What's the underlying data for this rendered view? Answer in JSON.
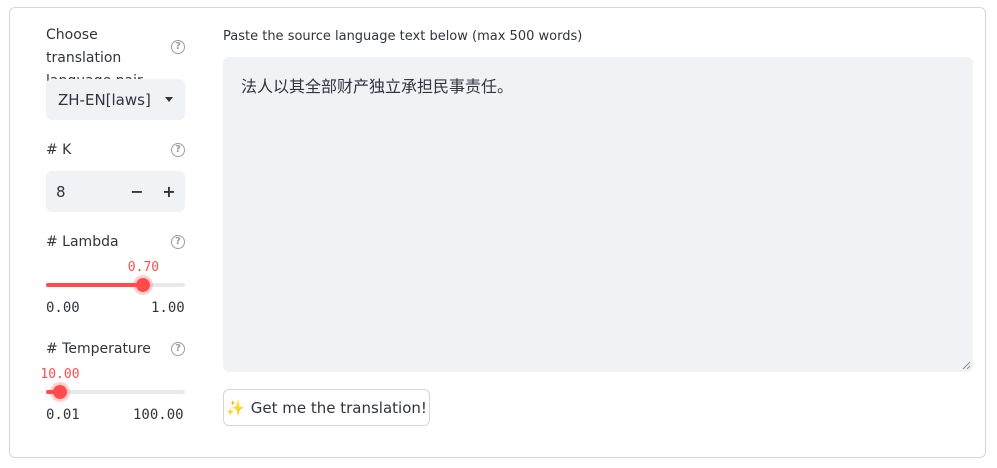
{
  "sidebar": {
    "pair": {
      "label": "Choose translation language pair",
      "selected": "ZH-EN[laws]"
    },
    "k": {
      "label": "# K",
      "value": "8",
      "minus": "−",
      "plus": "+"
    },
    "lambda": {
      "label": "# Lambda",
      "value": "0.70",
      "min": "0.00",
      "max": "1.00",
      "level": 0.7
    },
    "temperature": {
      "label": "# Temperature",
      "value": "10.00",
      "min": "0.01",
      "max": "100.00",
      "level": 0.1
    },
    "help_glyph": "?"
  },
  "main": {
    "source_label": "Paste the source language text below (max 500 words)",
    "source_text": "法人以其全部财产独立承担民事责任。",
    "button": {
      "icon": "✨",
      "label": "Get me the translation!"
    }
  },
  "colors": {
    "accent": "#ff4b4b",
    "input_bg": "#f0f2f6"
  }
}
